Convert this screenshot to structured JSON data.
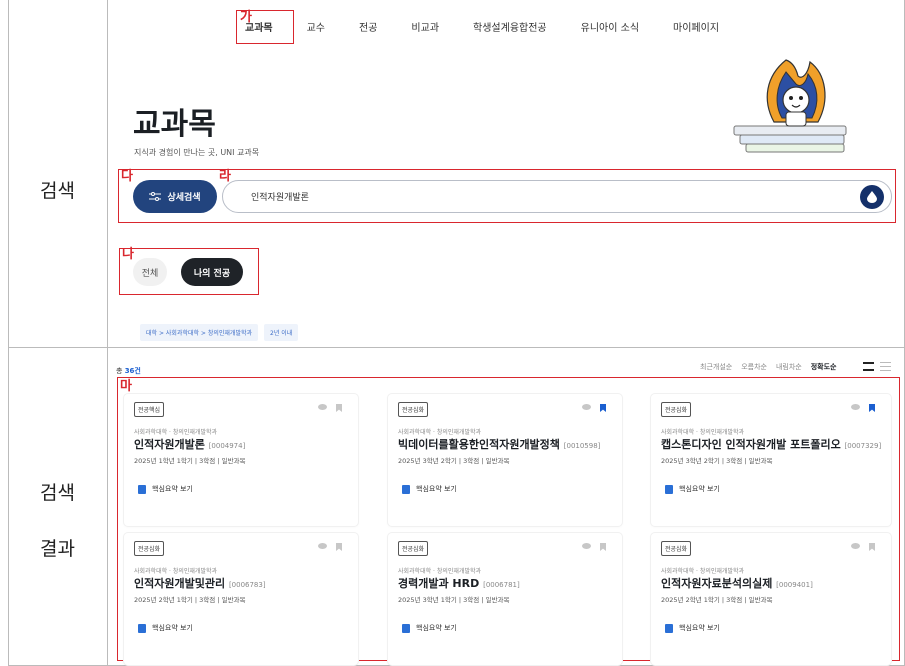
{
  "side_labels": {
    "search": "검색",
    "results_1": "검색",
    "results_2": "결과"
  },
  "annotations": {
    "ga": "가",
    "na": "나",
    "da": "다",
    "ra": "라",
    "ma": "마"
  },
  "nav": {
    "items": [
      "교과목",
      "교수",
      "전공",
      "비교과",
      "학생설계융합전공",
      "유니아이 소식",
      "마이페이지"
    ]
  },
  "page": {
    "title": "교과목",
    "subtitle": "지식과 경험이 만나는 곳, UNI 교과목"
  },
  "search": {
    "detail_label": "상세검색",
    "query": "인적자원개발론"
  },
  "filter": {
    "all": "전체",
    "my_major": "나의 전공"
  },
  "breadcrumb": {
    "path": "대학 > 사회과학대학 > 창의인재개발학과",
    "years": "2년 이내"
  },
  "results": {
    "total_prefix": "총",
    "total_count": "36건",
    "sorts": [
      "최근개설순",
      "오름차순",
      "내림차순",
      "정확도순"
    ],
    "active_sort": "정확도순"
  },
  "cards": [
    {
      "tag": "전공핵심",
      "dept": "사회과학대학 · 창의인재개발학과",
      "title": "인적자원개발론",
      "code": "[0004974]",
      "meta": "2025년 1학년 1학기  |  3학점  |  일반과목",
      "button": "핵심요약 보기",
      "bookmarked": false
    },
    {
      "tag": "전공심화",
      "dept": "사회과학대학 · 창의인재개발학과",
      "title": "빅데이터를활용한인적자원개발정책",
      "code": "[0010598]",
      "meta": "2025년 3학년 2학기  |  3학점  |  일반과목",
      "button": "핵심요약 보기",
      "bookmarked": true
    },
    {
      "tag": "전공심화",
      "dept": "사회과학대학 · 창의인재개발학과",
      "title": "캡스톤디자인 인적자원개발 포트폴리오",
      "code": "[0007329]",
      "meta": "2025년 3학년 2학기  |  3학점  |  일반과목",
      "button": "핵심요약 보기",
      "bookmarked": true
    },
    {
      "tag": "전공심화",
      "dept": "사회과학대학 · 창의인재개발학과",
      "title": "인적자원개발및관리",
      "code": "[0006783]",
      "meta": "2025년 2학년 1학기  |  3학점  |  일반과목",
      "button": "핵심요약 보기",
      "bookmarked": false
    },
    {
      "tag": "전공심화",
      "dept": "사회과학대학 · 창의인재개발학과",
      "title": "경력개발과 HRD",
      "code": "[0006781]",
      "meta": "2025년 3학년 1학기  |  3학점  |  일반과목",
      "button": "핵심요약 보기",
      "bookmarked": false
    },
    {
      "tag": "전공심화",
      "dept": "사회과학대학 · 창의인재개발학과",
      "title": "인적자원자료분석의실제",
      "code": "[0009401]",
      "meta": "2025년 2학년 1학기  |  3학점  |  일반과목",
      "button": "핵심요약 보기",
      "bookmarked": false
    }
  ],
  "colors": {
    "annotation_red": "#d9272e",
    "primary_navy": "#22447e",
    "accent_blue": "#1b5fd0"
  }
}
